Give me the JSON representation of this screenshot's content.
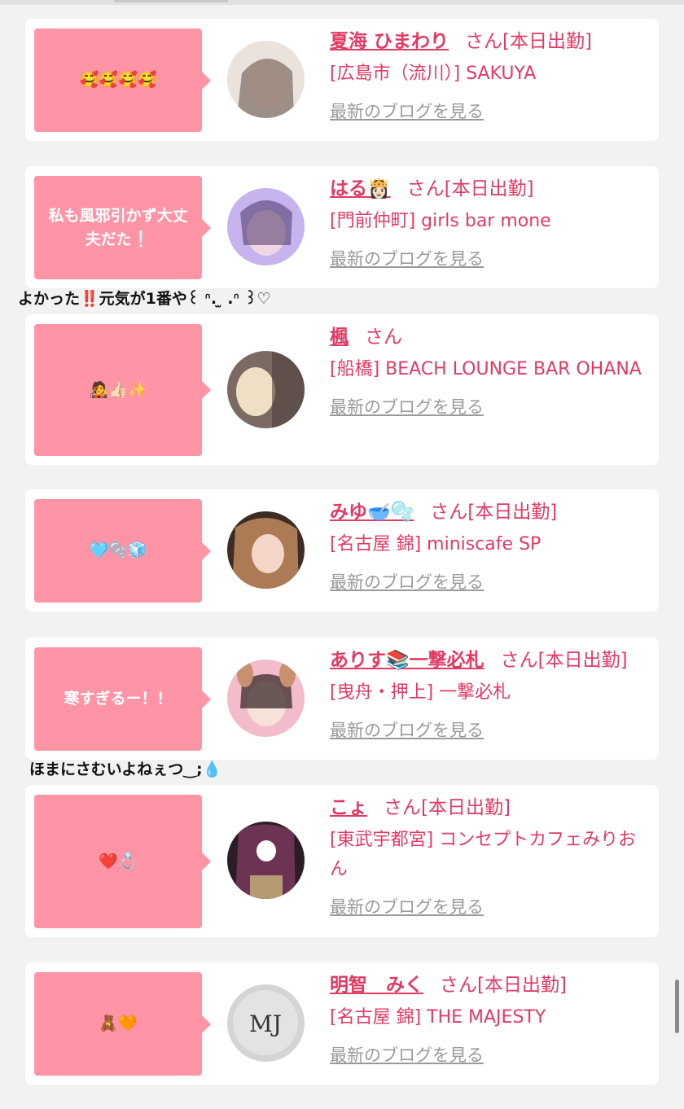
{
  "cards": [
    {
      "message": "🥰🥰🥰🥰",
      "name": "夏海 ひまわり",
      "suffix": "さん[本日出勤]",
      "shop": "[広島市（流川）] SAKUYA",
      "blog_link": "最新のブログを見る",
      "avatar_colors": [
        "#e8dcd6",
        "#5a4a44"
      ]
    },
    {
      "message": "私も風邪引かず大丈夫だた❕",
      "name": "はる👸🏻",
      "suffix": "さん[本日出勤]",
      "shop": "[門前仲町] girls bar mone",
      "blog_link": "最新のブログを見る",
      "avatar_colors": [
        "#cbb6f0",
        "#5b3f84"
      ]
    },
    {
      "message": "🧑‍🎤👍🏻✨",
      "name": "楓",
      "suffix": "さん",
      "shop": "[船橋] BEACH LOUNGE BAR OHANA",
      "blog_link": "最新のブログを見る",
      "avatar_colors": [
        "#e9d3a4",
        "#6d5a4e"
      ]
    },
    {
      "message": "🩵🫧🧊",
      "name": "みゆ🥣🫧",
      "suffix": "さん[本日出勤]",
      "shop": "[名古屋 錦] miniscafe SP",
      "blog_link": "最新のブログを見る",
      "avatar_colors": [
        "#d7a57f",
        "#3e2b24"
      ]
    },
    {
      "message": "寒すぎるー！！",
      "name": "ありす📚一撃必札",
      "suffix": "さん[本日出勤]",
      "shop": "[曳舟・押上] 一撃必札",
      "blog_link": "最新のブログを見る",
      "avatar_colors": [
        "#f2b8c6",
        "#5b3a3a"
      ]
    },
    {
      "message": "❤️💍",
      "name": "こょ",
      "suffix": "さん[本日出勤]",
      "shop": "[東武宇都宮] コンセプトカフェみりおん",
      "blog_link": "最新のブログを見る",
      "avatar_colors": [
        "#a3738a",
        "#2b1d24"
      ]
    },
    {
      "message": "🧸🧡",
      "name": "明智　みく",
      "suffix": "さん[本日出勤]",
      "shop": "[名古屋 錦] THE MAJESTY",
      "blog_link": "最新のブログを見る",
      "avatar_colors": [
        "#d6d6d6",
        "#9a9a9a"
      ],
      "avatar_logo": "MJ"
    }
  ],
  "overflow_texts": [
    "よかった‼️元気が1番や꒰ ᐢ. ̫ .ᐢ ꒱♡",
    "ほまにさむいよねぇつ‿;💧"
  ]
}
